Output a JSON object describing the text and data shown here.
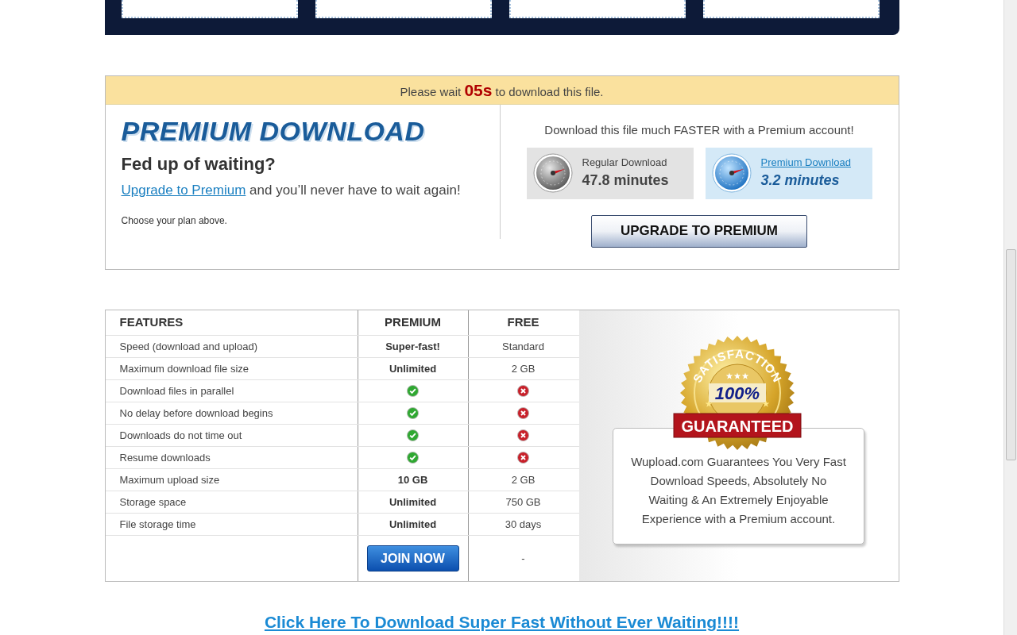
{
  "wait_bar": {
    "before": "Please wait",
    "countdown": "05s",
    "after": "to download this file."
  },
  "promo": {
    "heading": "PREMIUM DOWNLOAD",
    "subheading": "Fed up of waiting?",
    "link": "Upgrade to Premium",
    "link_rest": " and you’ll never have to wait again!",
    "note": "Choose your plan above."
  },
  "comparison": {
    "headline": "Download this file much FASTER with a Premium account!",
    "options": [
      {
        "kind": "regular",
        "label": "Regular Download",
        "time": "47.8 minutes"
      },
      {
        "kind": "premium",
        "label": "Premium Download",
        "time": "3.2 minutes"
      }
    ],
    "button": "UPGRADE TO PREMIUM"
  },
  "features_table": {
    "columns": [
      "FEATURES",
      "PREMIUM",
      "FREE"
    ],
    "rows": [
      {
        "feature": "Speed (download and upload)",
        "premium": {
          "kind": "text",
          "text": "Super-fast!"
        },
        "free": {
          "kind": "text",
          "text": "Standard"
        }
      },
      {
        "feature": "Maximum download file size",
        "premium": {
          "kind": "text",
          "text": "Unlimited"
        },
        "free": {
          "kind": "text",
          "text": "2 GB"
        }
      },
      {
        "feature": "Download files in parallel",
        "premium": {
          "kind": "check"
        },
        "free": {
          "kind": "cross"
        }
      },
      {
        "feature": "No delay before download begins",
        "premium": {
          "kind": "check"
        },
        "free": {
          "kind": "cross"
        }
      },
      {
        "feature": "Downloads do not time out",
        "premium": {
          "kind": "check"
        },
        "free": {
          "kind": "cross"
        }
      },
      {
        "feature": "Resume downloads",
        "premium": {
          "kind": "check"
        },
        "free": {
          "kind": "cross"
        }
      },
      {
        "feature": "Maximum upload size",
        "premium": {
          "kind": "text",
          "text": "10 GB"
        },
        "free": {
          "kind": "text",
          "text": "2 GB"
        }
      },
      {
        "feature": "Storage space",
        "premium": {
          "kind": "text",
          "text": "Unlimited"
        },
        "free": {
          "kind": "text",
          "text": "750 GB"
        }
      },
      {
        "feature": "File storage time",
        "premium": {
          "kind": "text",
          "text": "Unlimited"
        },
        "free": {
          "kind": "text",
          "text": "30 days"
        }
      }
    ],
    "footer": {
      "premium_button": "JOIN NOW",
      "free": "-"
    }
  },
  "guarantee": {
    "seal": {
      "arc": "SATISFACTION",
      "middle": "100%",
      "ribbon": "GUARANTEED"
    },
    "text": "Wupload.com Guarantees You Very Fast Download Speeds, Absolutely No Waiting & An Extremely Enjoyable Experience with a Premium account."
  },
  "bottom_link": "Click Here To Download Super Fast Without Ever Waiting!!!!"
}
